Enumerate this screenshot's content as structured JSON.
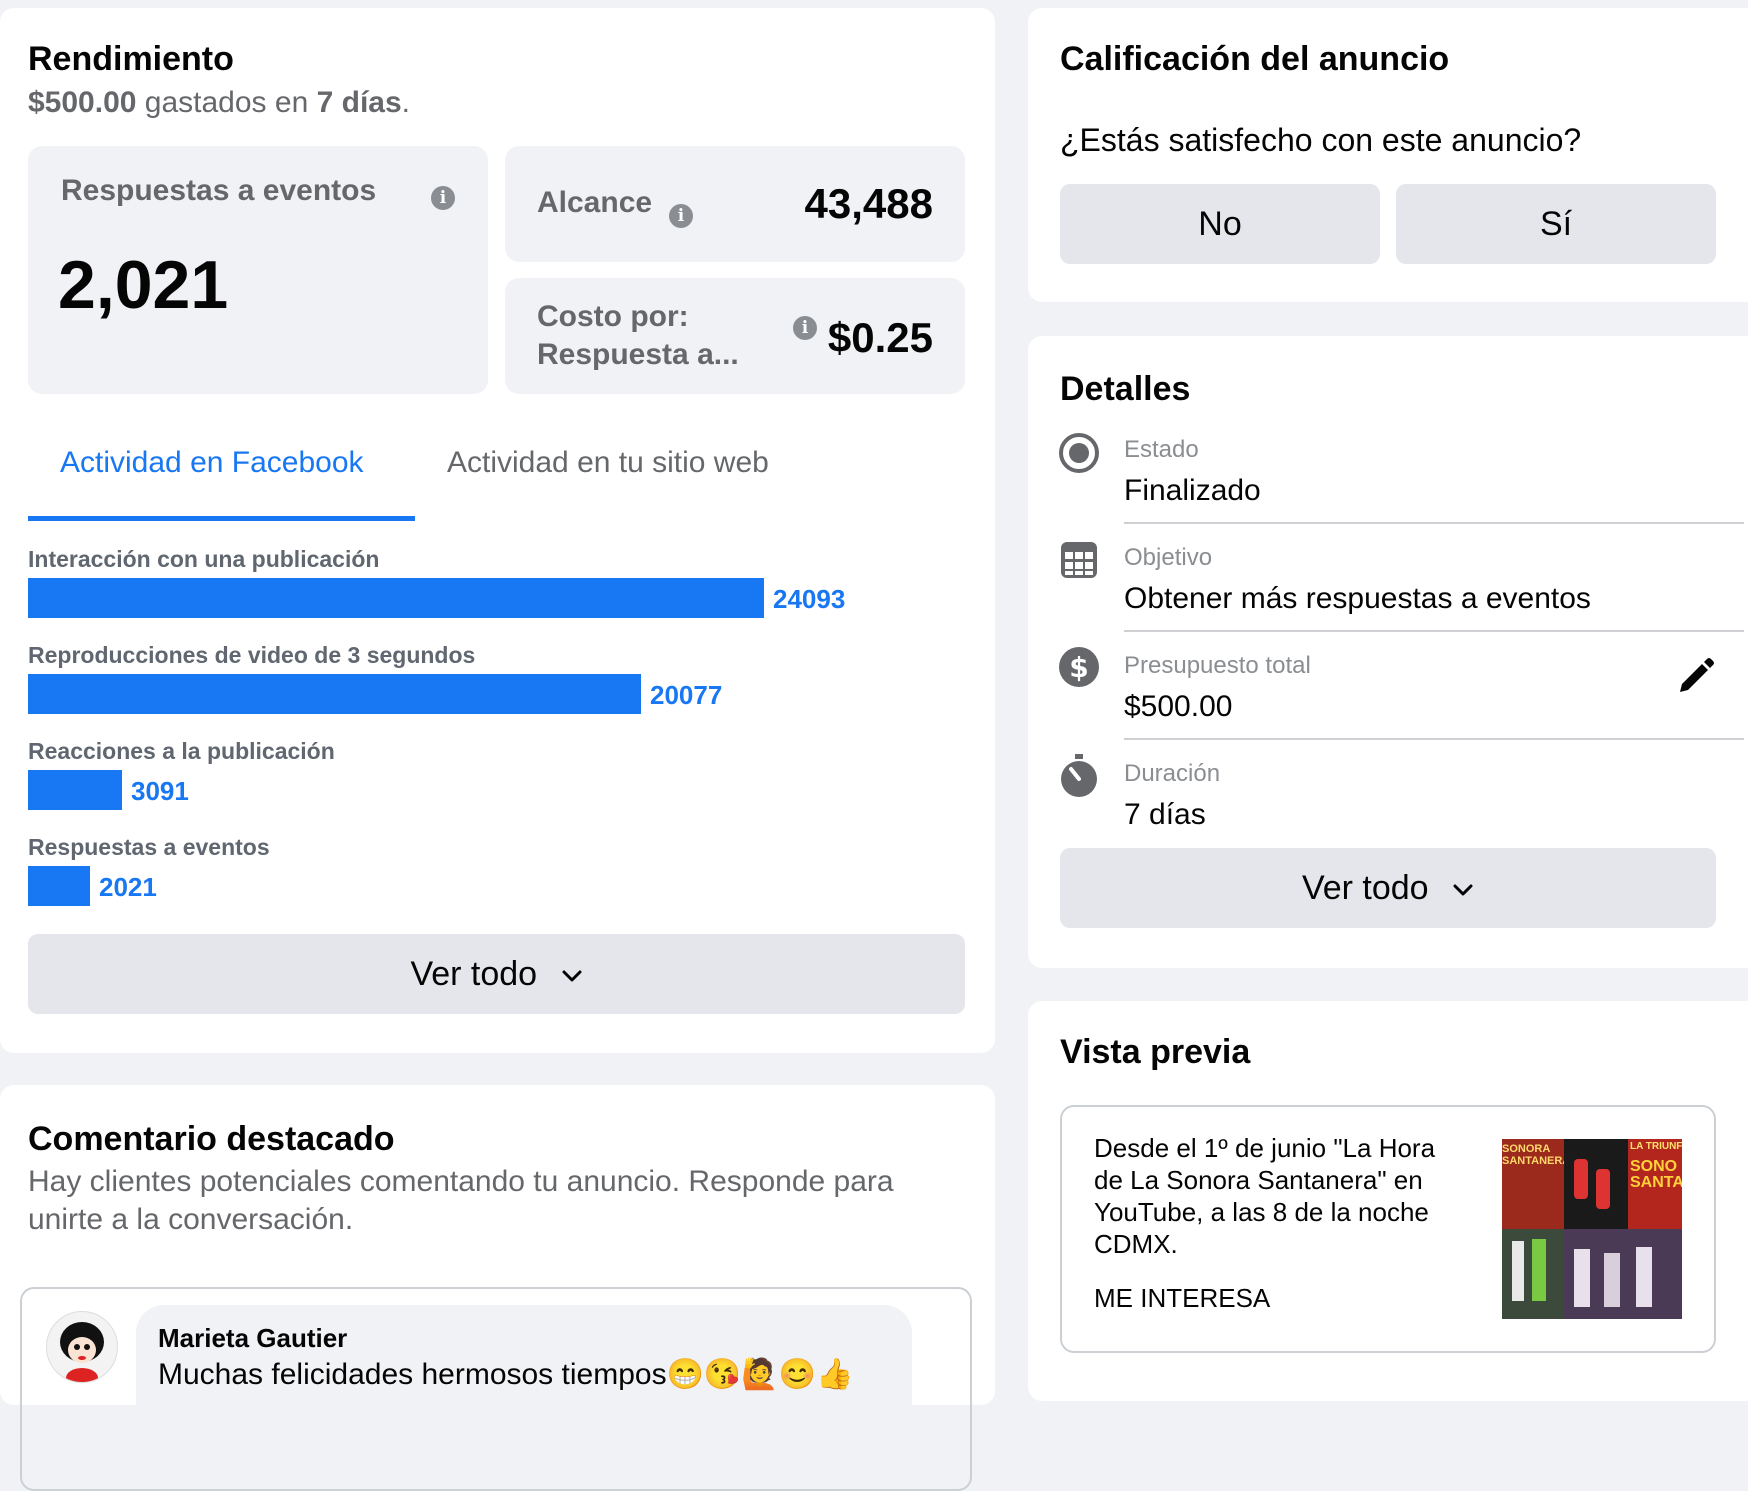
{
  "performance": {
    "title": "Rendimiento",
    "spent_amount": "$500.00",
    "spent_mid": "gastados en",
    "spent_days": "7 días",
    "spent_end": ".",
    "results_label": "Respuestas a eventos",
    "results_value": "2,021",
    "reach_label": "Alcance",
    "reach_value": "43,488",
    "cost_label_line1": "Costo por:",
    "cost_label_line2": "Respuesta a...",
    "cost_value": "$0.25",
    "tabs": [
      "Actividad en Facebook",
      "Actividad en tu sitio web"
    ],
    "active_tab": 0,
    "see_all": "Ver todo"
  },
  "chart_data": {
    "type": "bar",
    "orientation": "horizontal",
    "categories": [
      "Interacción con una publicación",
      "Reproducciones de video de 3 segundos",
      "Reacciones a la publicación",
      "Respuestas a eventos"
    ],
    "values": [
      24093,
      20077,
      3091,
      2021
    ],
    "value_labels": [
      "24093",
      "20077",
      "3091",
      "2021"
    ],
    "color": "#1877f2"
  },
  "featured_comment": {
    "title": "Comentario destacado",
    "subtitle_line1": "Hay clientes potenciales comentando tu anuncio. Responde para",
    "subtitle_line2": "unirte a la conversación.",
    "author": "Marieta Gautier",
    "text": "Muchas felicidades hermosos tiempos😁😘🙋😊👍"
  },
  "rating": {
    "title": "Calificación del anuncio",
    "question": "¿Estás satisfecho con este anuncio?",
    "no_label": "No",
    "yes_label": "Sí"
  },
  "details": {
    "title": "Detalles",
    "items": [
      {
        "label": "Estado",
        "value": "Finalizado",
        "icon": "radio-icon"
      },
      {
        "label": "Objetivo",
        "value": "Obtener más respuestas a eventos",
        "icon": "calendar-grid-icon"
      },
      {
        "label": "Presupuesto total",
        "value": "$500.00",
        "icon": "dollar-icon"
      },
      {
        "label": "Duración",
        "value": "7 días",
        "icon": "stopwatch-icon"
      }
    ],
    "see_all": "Ver todo"
  },
  "preview": {
    "title": "Vista previa",
    "lines": [
      "Desde el 1º de junio \"La Hora",
      "de La Sonora Santanera\" en",
      "YouTube, a las 8 de la noche",
      "CDMX."
    ],
    "cta": "ME INTERESA",
    "thumb_texts": [
      "SONORA SANTANERA",
      "LA TRIUNF",
      "SONO SANTAN"
    ]
  },
  "colors": {
    "accent": "#1877f2",
    "background": "#f0f2f5",
    "tile": "#f0f2f5",
    "button": "#e4e6eb"
  }
}
